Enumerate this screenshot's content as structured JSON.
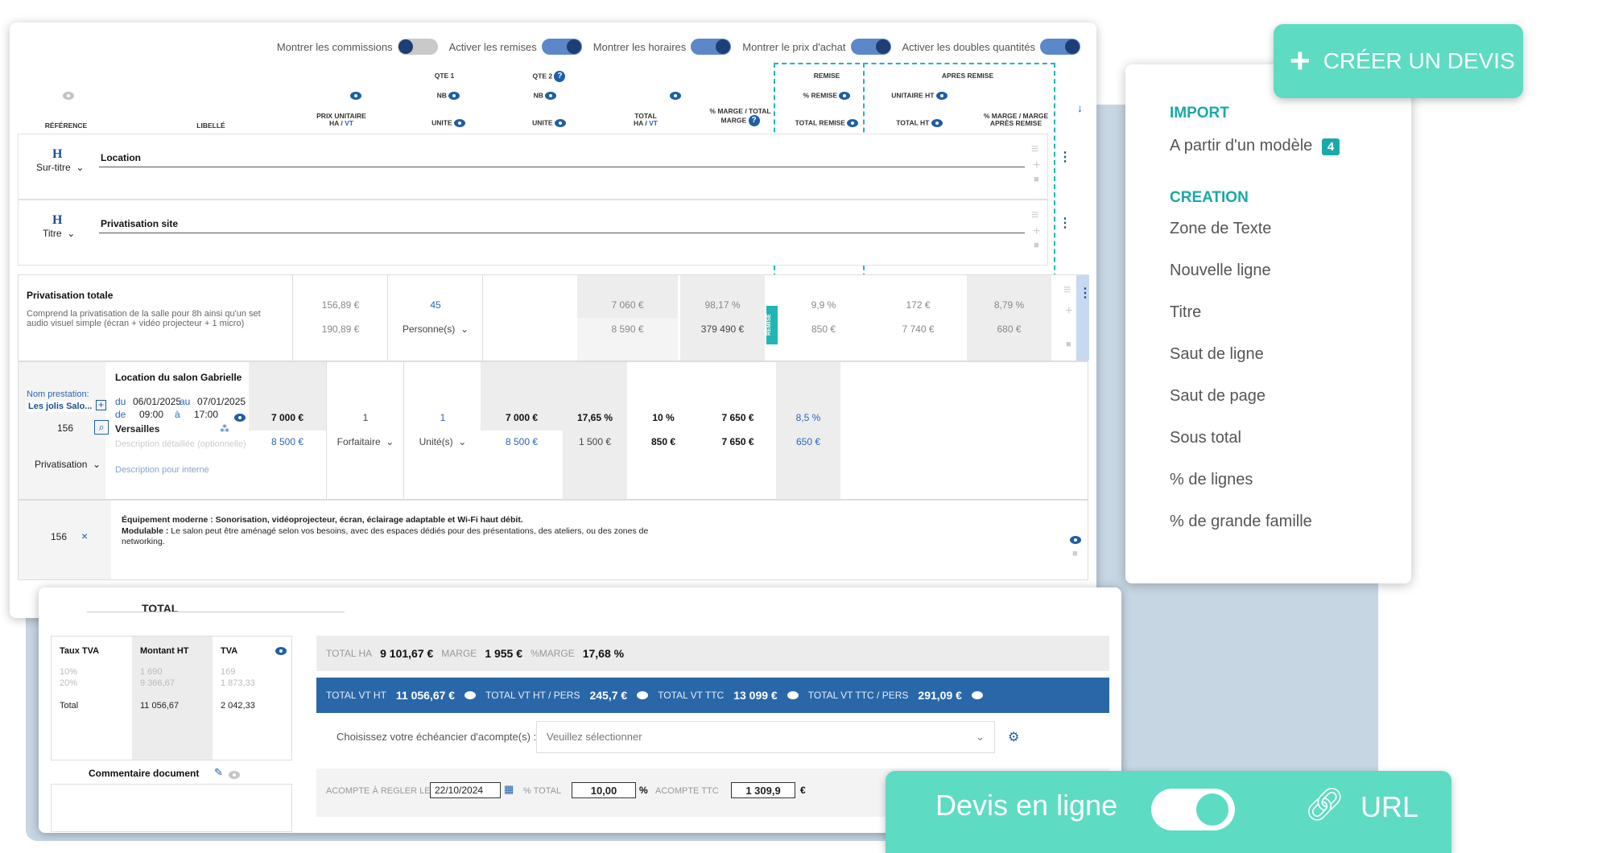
{
  "toggles": [
    {
      "label": "Montrer les commissions",
      "on": false
    },
    {
      "label": "Activer les remises",
      "on": true
    },
    {
      "label": "Montrer les horaires",
      "on": true
    },
    {
      "label": "Montrer le prix d'achat",
      "on": true
    },
    {
      "label": "Activer les doubles quantités",
      "on": true
    }
  ],
  "headers": {
    "reference": "RÉFÉRENCE",
    "libelle": "LIBELLÉ",
    "prix_unitaire": "PRIX UNITAIRE",
    "ha": "HA",
    "vt": "VT",
    "qte1": "QTE 1",
    "qte2": "QTE 2",
    "nb": "NB",
    "unite": "UNITE",
    "total": "TOTAL",
    "marge_total": "% MARGE / TOTAL",
    "marge": "MARGE",
    "remise": "REMISE",
    "pct_remise": "% REMISE",
    "total_remise": "TOTAL REMISE",
    "apres_remise": "APRES REMISE",
    "unitaire_ht": "UNITAIRE HT",
    "total_ht": "TOTAL HT",
    "marge_apres": "% MARGE / MARGE",
    "apres_remise2": "APRÈS REMISE"
  },
  "rows": {
    "r1": {
      "icon": "H",
      "select": "Sur-titre",
      "label": "Location"
    },
    "r2": {
      "icon": "H",
      "select": "Titre",
      "label": "Privatisation site"
    },
    "r3": {
      "title": "Privatisation totale",
      "desc": "Comprend la privatisation de la salle pour 8h ainsi qu'un set audio visuel simple (écran + vidéo projecteur + 1 micro)",
      "pu_ha": "156,89 €",
      "pu_vt": "190,89 €",
      "nb": "45",
      "unite": "Personne(s)",
      "total_ha": "7 060 €",
      "total_vt": "8 590 €",
      "marge_pct": "98,17 %",
      "marge": "379 490 €",
      "remise_tag": "REMISE",
      "remise_pct": "9,9 %",
      "total_remise": "850 €",
      "unit_ht": "172 €",
      "total_ht": "7 740 €",
      "marge_apres_pct": "8,79 %",
      "marge_apres": "680 €"
    },
    "r4": {
      "nom_label": "Nom prestation:",
      "nom_value": "Les jolis Salo...",
      "code": "156",
      "select": "Privatisation",
      "title": "Location du salon Gabrielle",
      "du": "du",
      "date_from": "06/01/2025",
      "au": "au",
      "date_to": "07/01/2025",
      "de": "de",
      "time_from": "09:00",
      "a": "à",
      "time_to": "17:00",
      "place": "Versailles",
      "desc_placeholder": "Description détaillée (optionnelle)",
      "desc_internal": "Description pour interne",
      "pu_ha": "7 000 €",
      "pu_vt": "8 500 €",
      "nb": "1",
      "unite": "Forfaitaire",
      "nb2": "1",
      "unite2": "Unité(s)",
      "total_ha": "7 000 €",
      "total_vt": "8 500 €",
      "marge_pct": "17,65 %",
      "marge": "1 500 €",
      "remise_pct": "10 %",
      "total_remise": "850 €",
      "unit_ht": "7 650 €",
      "total_ht": "7 650 €",
      "marge_apres_pct": "8,5 %",
      "marge_apres": "650 €"
    },
    "r5": {
      "code": "156",
      "x": "×",
      "line1_b": "Équipement moderne :",
      "line1": " Sonorisation, vidéoprojecteur, écran, éclairage adaptable et Wi-Fi haut débit.",
      "line2_b": "Modulable :",
      "line2": " Le salon peut être aménagé selon vos besoins, avec des espaces dédiés pour des présentations, des ateliers, ou des zones de",
      "line3": "networking."
    }
  },
  "total": {
    "title": "TOTAL",
    "vat_headers": [
      "Taux TVA",
      "Montant HT",
      "TVA"
    ],
    "vat_rows": [
      [
        "10%",
        "1 690",
        "169"
      ],
      [
        "20%",
        "9 366,67",
        "1 873,33"
      ]
    ],
    "vat_total": [
      "Total",
      "11 056,67",
      "2 042,33"
    ],
    "comment_label": "Commentaire document",
    "total_ha_label": "TOTAL HA",
    "total_ha": "9 101,67 €",
    "marge_label": "MARGE",
    "marge": "1 955 €",
    "pct_marge_label": "%MARGE",
    "pct_marge": "17,68 %",
    "vt_ht_label": "TOTAL VT HT",
    "vt_ht": "11 056,67 €",
    "vt_ht_pers_label": "TOTAL VT HT / PERS",
    "vt_ht_pers": "245,7 €",
    "vt_ttc_label": "TOTAL VT TTC",
    "vt_ttc": "13 099 €",
    "vt_ttc_pers_label": "TOTAL VT TTC / PERS",
    "vt_ttc_pers": "291,09 €",
    "echeancier_label": "Choisissez votre échéancier d'acompte(s) :",
    "echeancier_placeholder": "Veuillez sélectionner",
    "acompte_label": "ACOMPTE À REGLER LE",
    "acompte_date": "22/10/2024",
    "pct_total_label": "% TOTAL",
    "pct_total": "10,00",
    "pct_sign": "%",
    "acompte_ttc_label": "ACOMPTE TTC",
    "acompte_ttc": "1 309,9",
    "euro": "€"
  },
  "menu": {
    "import_heading": "IMPORT",
    "from_model": "A partir d'un modèle",
    "from_model_badge": "4",
    "creation_heading": "CREATION",
    "items": [
      "Zone de Texte",
      "Nouvelle ligne",
      "Titre",
      "Saut de ligne",
      "Saut de page",
      "Sous total",
      "% de lignes",
      "% de grande famille"
    ]
  },
  "creer_label": "CRÉER UN DEVIS",
  "devis_en_ligne": "Devis en ligne",
  "url_label": "URL",
  "colors": {
    "accent": "#5ddbc3",
    "primary": "#2a67a8",
    "teal": "#1ba8a8"
  }
}
